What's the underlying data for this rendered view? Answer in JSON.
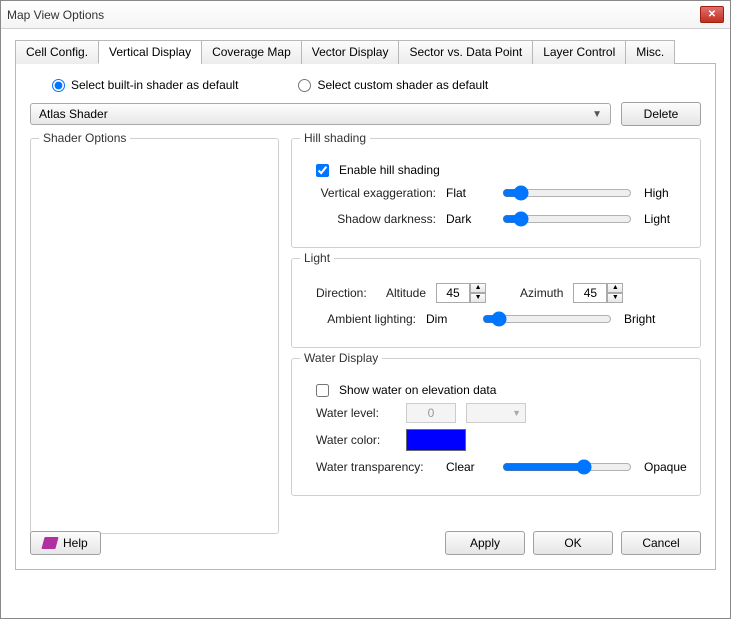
{
  "window": {
    "title": "Map View Options"
  },
  "tabs": [
    {
      "label": "Cell Config."
    },
    {
      "label": "Vertical Display"
    },
    {
      "label": "Coverage Map"
    },
    {
      "label": "Vector Display"
    },
    {
      "label": "Sector vs. Data Point"
    },
    {
      "label": "Layer Control"
    },
    {
      "label": "Misc."
    }
  ],
  "radios": {
    "builtin": "Select built-in shader as default",
    "custom": "Select custom shader as default"
  },
  "shader_combo": "Atlas Shader",
  "delete_btn": "Delete",
  "shader_options": {
    "legend": "Shader Options"
  },
  "hill": {
    "legend": "Hill shading",
    "enable": "Enable hill shading",
    "vexag": "Vertical exaggeration:",
    "shadow": "Shadow darkness:",
    "flat": "Flat",
    "high": "High",
    "dark": "Dark",
    "light": "Light"
  },
  "light": {
    "legend": "Light",
    "direction": "Direction:",
    "altitude": "Altitude",
    "alt_val": "45",
    "azimuth": "Azimuth",
    "az_val": "45",
    "ambient": "Ambient lighting:",
    "dim": "Dim",
    "bright": "Bright"
  },
  "water": {
    "legend": "Water Display",
    "show": "Show water on elevation data",
    "level": "Water level:",
    "level_val": "0",
    "color": "Water color:",
    "color_val": "#0000ff",
    "trans": "Water transparency:",
    "clear": "Clear",
    "opaque": "Opaque"
  },
  "buttons": {
    "help": "Help",
    "apply": "Apply",
    "ok": "OK",
    "cancel": "Cancel"
  }
}
